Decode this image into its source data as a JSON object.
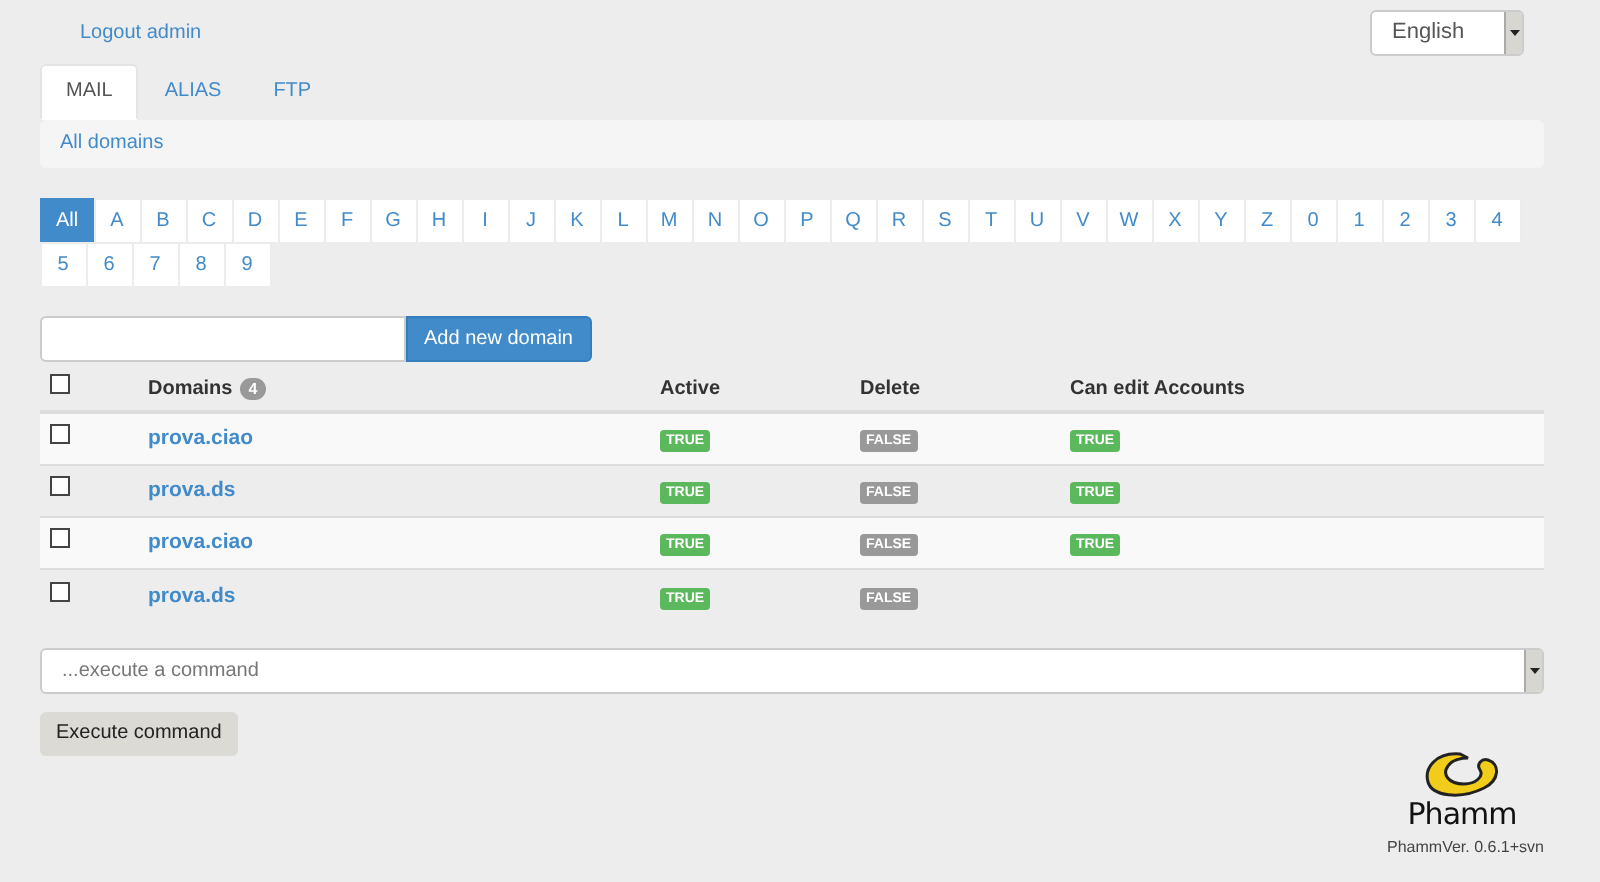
{
  "header": {
    "logout": "Logout admin",
    "language": "English"
  },
  "tabs": [
    {
      "label": "MAIL",
      "selected": true
    },
    {
      "label": "ALIAS",
      "selected": false
    },
    {
      "label": "FTP",
      "selected": false
    }
  ],
  "breadcrumb": "All domains",
  "letters": [
    {
      "label": "All",
      "selected": true
    },
    {
      "label": "A",
      "selected": false
    },
    {
      "label": "B",
      "selected": false
    },
    {
      "label": "C",
      "selected": false
    },
    {
      "label": "D",
      "selected": false
    },
    {
      "label": "E",
      "selected": false
    },
    {
      "label": "F",
      "selected": false
    },
    {
      "label": "G",
      "selected": false
    },
    {
      "label": "H",
      "selected": false
    },
    {
      "label": "I",
      "selected": false
    },
    {
      "label": "J",
      "selected": false
    },
    {
      "label": "K",
      "selected": false
    },
    {
      "label": "L",
      "selected": false
    },
    {
      "label": "M",
      "selected": false
    },
    {
      "label": "N",
      "selected": false
    },
    {
      "label": "O",
      "selected": false
    },
    {
      "label": "P",
      "selected": false
    },
    {
      "label": "Q",
      "selected": false
    },
    {
      "label": "R",
      "selected": false
    },
    {
      "label": "S",
      "selected": false
    },
    {
      "label": "T",
      "selected": false
    },
    {
      "label": "U",
      "selected": false
    },
    {
      "label": "V",
      "selected": false
    },
    {
      "label": "W",
      "selected": false
    },
    {
      "label": "X",
      "selected": false
    },
    {
      "label": "Y",
      "selected": false
    },
    {
      "label": "Z",
      "selected": false
    },
    {
      "label": "0",
      "selected": false
    },
    {
      "label": "1",
      "selected": false
    },
    {
      "label": "2",
      "selected": false
    },
    {
      "label": "3",
      "selected": false
    },
    {
      "label": "4",
      "selected": false
    },
    {
      "label": "5",
      "selected": false
    },
    {
      "label": "6",
      "selected": false
    },
    {
      "label": "7",
      "selected": false
    },
    {
      "label": "8",
      "selected": false
    },
    {
      "label": "9",
      "selected": false
    }
  ],
  "add_button": "Add new domain",
  "table": {
    "select_all_checked": false,
    "columns": [
      "Domains",
      "Active",
      "Delete",
      "Can edit Accounts"
    ],
    "domain_count": "4",
    "rows": [
      {
        "checked": false,
        "cells": [
          {
            "label": "prova.ciao",
            "kind": "link"
          },
          {
            "label": "TRUE",
            "kind": "true"
          },
          {
            "label": "FALSE",
            "kind": "false"
          },
          {
            "label": "TRUE",
            "kind": "true"
          }
        ]
      },
      {
        "checked": false,
        "cells": [
          {
            "label": "prova.ds",
            "kind": "link"
          },
          {
            "label": "TRUE",
            "kind": "true"
          },
          {
            "label": "FALSE",
            "kind": "false"
          },
          {
            "label": "TRUE",
            "kind": "true"
          }
        ]
      },
      {
        "checked": false,
        "cells": [
          {
            "label": "prova.ciao",
            "kind": "link"
          },
          {
            "label": "TRUE",
            "kind": "true"
          },
          {
            "label": "FALSE",
            "kind": "false"
          },
          {
            "label": "TRUE",
            "kind": "true"
          }
        ]
      },
      {
        "checked": false,
        "cells": [
          {
            "label": "prova.ds",
            "kind": "link"
          },
          {
            "label": "TRUE",
            "kind": "true"
          },
          {
            "label": "FALSE",
            "kind": "false"
          }
        ]
      }
    ]
  },
  "command": {
    "value": "...execute a command",
    "button": "Execute command"
  },
  "footer": {
    "logo_text": "Phamm",
    "version": "PhammVer. 0.6.1+svn"
  }
}
